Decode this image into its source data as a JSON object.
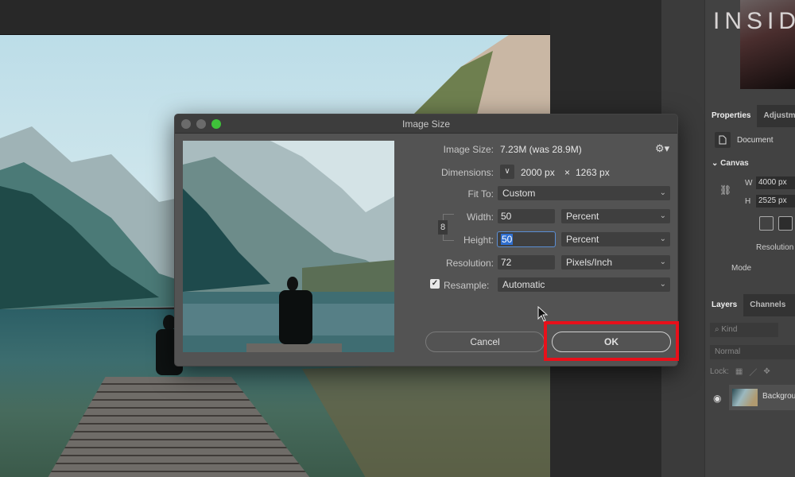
{
  "dialog": {
    "title": "Image Size",
    "image_size_label": "Image Size:",
    "image_size_value": "7.23M (was 28.9M)",
    "dimensions_label": "Dimensions:",
    "dimensions_width": "2000 px",
    "dimensions_times": "×",
    "dimensions_height": "1263 px",
    "fit_to_label": "Fit To:",
    "fit_to_value": "Custom",
    "width_label": "Width:",
    "width_value": "50",
    "width_unit": "Percent",
    "height_label": "Height:",
    "height_value": "50",
    "height_unit": "Percent",
    "resolution_label": "Resolution:",
    "resolution_value": "72",
    "resolution_unit": "Pixels/Inch",
    "resample_label": "Resample:",
    "resample_checked": true,
    "resample_value": "Automatic",
    "cancel_label": "Cancel",
    "ok_label": "OK",
    "icons": {
      "gear": "gear-icon",
      "chain": "link-icon",
      "check": "checkmark-icon",
      "chevron": "chevron-down-icon"
    },
    "traffic_lights": [
      "#6b6b6b",
      "#6b6b6b",
      "#3fc23a"
    ],
    "highlight_color": "#e8101a"
  },
  "right_panel": {
    "watermark": "INSIDER",
    "properties_tabs": [
      "Properties",
      "Adjustments"
    ],
    "document_label": "Document",
    "canvas_section": "Canvas",
    "canvas_w_label": "W",
    "canvas_w_value": "4000 px",
    "canvas_h_label": "H",
    "canvas_h_value": "2525 px",
    "resolution_label": "Resolution",
    "mode_label": "Mode",
    "layers_tabs": [
      "Layers",
      "Channels"
    ],
    "kind_placeholder": "Kind",
    "blend_mode": "Normal",
    "lock_label": "Lock:",
    "layer_name": "Background"
  }
}
